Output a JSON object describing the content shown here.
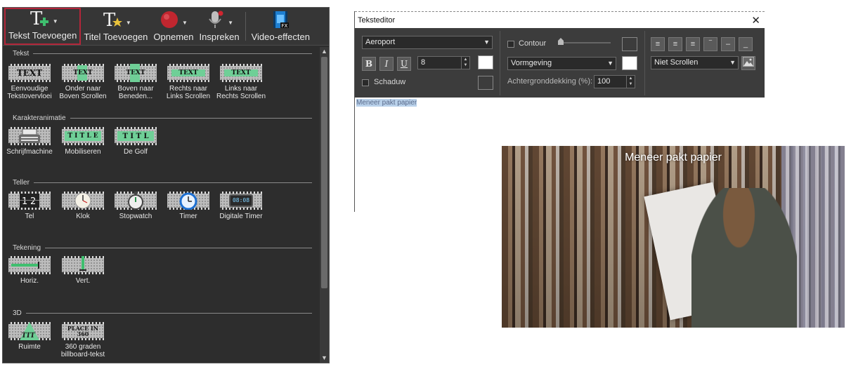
{
  "toolbar": {
    "buttons": [
      {
        "label": "Tekst Toevoegen",
        "icon": "text-add-icon"
      },
      {
        "label": "Titel Toevoegen",
        "icon": "title-add-icon"
      },
      {
        "label": "Opnemen",
        "icon": "record-icon"
      },
      {
        "label": "Inspreken",
        "icon": "microphone-icon"
      },
      {
        "label": "Video-effecten",
        "icon": "video-effects-icon"
      }
    ]
  },
  "library": {
    "categories": [
      {
        "title": "Tekst",
        "items": [
          {
            "label": "Eenvoudige\nTekstovervloei",
            "thumb": "TEXT"
          },
          {
            "label": "Onder naar\nBoven Scrollen",
            "thumb": "TEXT"
          },
          {
            "label": "Boven naar\nBeneden...",
            "thumb": "TEXT"
          },
          {
            "label": "Rechts naar\nLinks Scrollen",
            "thumb": "TEXT"
          },
          {
            "label": "Links naar\nRechts Scrollen",
            "thumb": "TEXT"
          }
        ]
      },
      {
        "title": "Karakteranimatie",
        "items": [
          {
            "label": "Schrijfmachine",
            "thumb": ""
          },
          {
            "label": "Mobiliseren",
            "thumb": "T I T L E"
          },
          {
            "label": "De Golf",
            "thumb": "T I T L"
          }
        ]
      },
      {
        "title": "Teller",
        "items": [
          {
            "label": "Tel",
            "thumb": ""
          },
          {
            "label": "Klok",
            "thumb": ""
          },
          {
            "label": "Stopwatch",
            "thumb": ""
          },
          {
            "label": "Timer",
            "thumb": ""
          },
          {
            "label": "Digitale Timer",
            "thumb": "08:08"
          }
        ]
      },
      {
        "title": "Tekening",
        "items": [
          {
            "label": "Horiz.",
            "thumb": ""
          },
          {
            "label": "Vert.",
            "thumb": ""
          }
        ]
      },
      {
        "title": "3D",
        "items": [
          {
            "label": "Ruimte",
            "thumb": ""
          },
          {
            "label": "360 graden\nbillboard-tekst",
            "thumb": "PLACE IN 360"
          }
        ]
      }
    ]
  },
  "editor": {
    "title": "Teksteditor",
    "font": "Aeroport",
    "font_size": "8",
    "bold": "B",
    "italic": "I",
    "underline": "U",
    "shadow_label": "Schaduw",
    "contour_label": "Contour",
    "style_dropdown": "Vormgeving",
    "bg_opacity_label": "Achtergronddekking (%):",
    "bg_opacity_value": "100",
    "scroll_dropdown": "Niet Scrollen",
    "text": "Meneer pakt papier"
  },
  "preview": {
    "caption": "Meneer pakt papier"
  }
}
